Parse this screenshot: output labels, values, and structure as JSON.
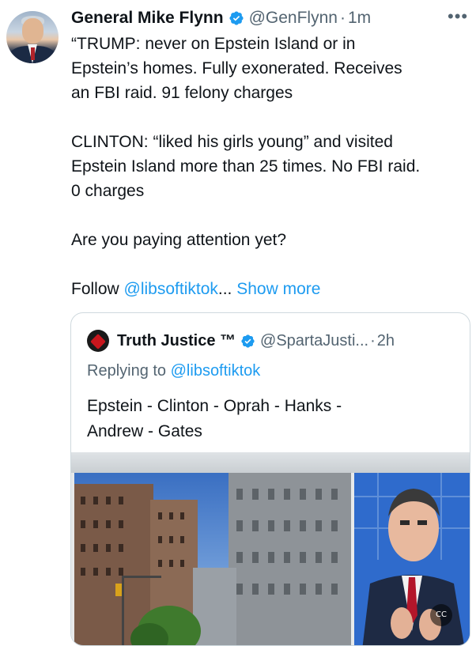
{
  "author": {
    "name": "General Mike Flynn",
    "handle": "@GenFlynn",
    "separator": "·",
    "time": "1m"
  },
  "menu_icon": "more-horizontal-icon",
  "post": {
    "lines": [
      "“TRUMP: never on Epstein Island or in",
      "Epstein’s homes. Fully exonerated. Receives",
      "an FBI raid. 91 felony charges"
    ],
    "para2": [
      "CLINTON: “liked his girls young” and visited",
      "Epstein Island more than 25 times. No FBI raid.",
      "0 charges"
    ],
    "para3": "Are you paying attention yet?",
    "follow_prefix": "Follow ",
    "follow_link": "@libsoftiktok",
    "ellipsis": "...",
    "show_more": "Show more"
  },
  "quote": {
    "name": "Truth Justice ™",
    "handle": "@SpartaJusti...",
    "separator": "·",
    "time": "2h",
    "replying_prefix": "Replying to ",
    "replying_to": "@libsoftiktok",
    "text_lines": [
      "Epstein - Clinton - Oprah - Hanks -",
      "Andrew - Gates"
    ],
    "media_badge": "CC"
  },
  "colors": {
    "link": "#1d9bf0",
    "secondary_text": "#536471",
    "verified_badge": "#1d9bf0"
  }
}
